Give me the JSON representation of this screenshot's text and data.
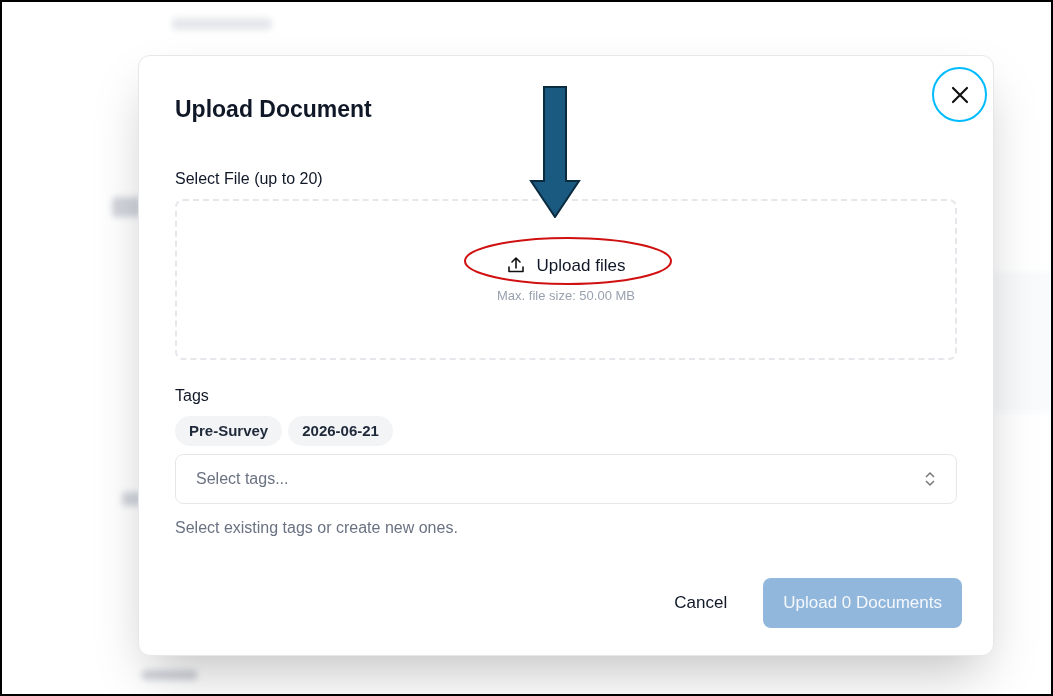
{
  "dialog": {
    "title": "Upload Document",
    "file_label": "Select File (up to 20)",
    "dropzone": {
      "action": "Upload files",
      "hint": "Max. file size: 50.00 MB"
    },
    "tags_label": "Tags",
    "tags": [
      "Pre-Survey",
      "2026-06-21"
    ],
    "tag_select": {
      "placeholder": "Select tags..."
    },
    "tags_help": "Select existing tags or create new ones.",
    "buttons": [
      {
        "kind": "secondary",
        "label": "Cancel",
        "disabled": false
      },
      {
        "kind": "primary",
        "label": "Upload 0 Documents",
        "disabled": true
      }
    ]
  }
}
